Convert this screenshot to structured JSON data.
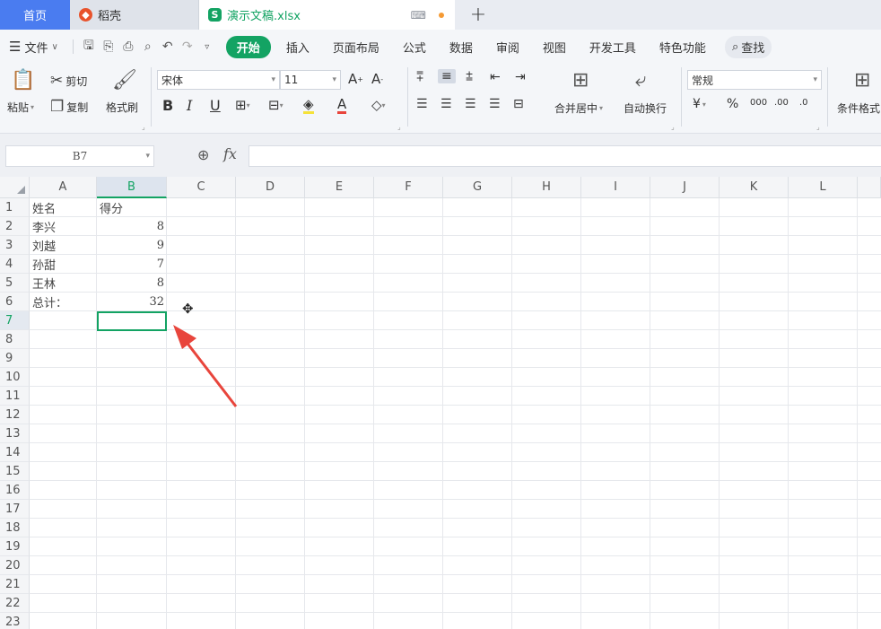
{
  "tabs": {
    "home": "首页",
    "daoke": "稻壳",
    "file": "演示文稿.xlsx",
    "add": "+"
  },
  "menu": {
    "file": "文件",
    "start": "开始",
    "items": [
      "插入",
      "页面布局",
      "公式",
      "数据",
      "审阅",
      "视图",
      "开发工具",
      "特色功能"
    ],
    "search": "查找"
  },
  "ribbon": {
    "paste": "粘贴",
    "cut": "剪切",
    "copy": "复制",
    "format_painter": "格式刷",
    "font_name": "宋体",
    "font_size": "11",
    "merge_center": "合并居中",
    "wrap_text": "自动换行",
    "number_format": "常规",
    "conditional_format": "条件格式"
  },
  "formula_bar": {
    "name_box": "B7",
    "fx": "fx",
    "formula": ""
  },
  "grid": {
    "columns": [
      "A",
      "B",
      "C",
      "D",
      "E",
      "F",
      "G",
      "H",
      "I",
      "J",
      "K",
      "L"
    ],
    "rows": [
      "1",
      "2",
      "3",
      "4",
      "5",
      "6",
      "7",
      "8",
      "9",
      "10",
      "11",
      "12",
      "13",
      "14",
      "15",
      "16",
      "17",
      "18",
      "19",
      "20",
      "21",
      "22",
      "23"
    ],
    "selected_column": "B",
    "selected_row": "7",
    "cells": [
      {
        "name": "姓名",
        "score": "得分"
      },
      {
        "name": "李兴",
        "score": "8"
      },
      {
        "name": "刘越",
        "score": "9"
      },
      {
        "name": "孙甜",
        "score": "7"
      },
      {
        "name": "王林",
        "score": "8"
      },
      {
        "name": "总计：",
        "score": "32"
      }
    ]
  },
  "colors": {
    "accent": "#13a363",
    "home_tab": "#4a7cf0",
    "arrow": "#e8453c"
  }
}
